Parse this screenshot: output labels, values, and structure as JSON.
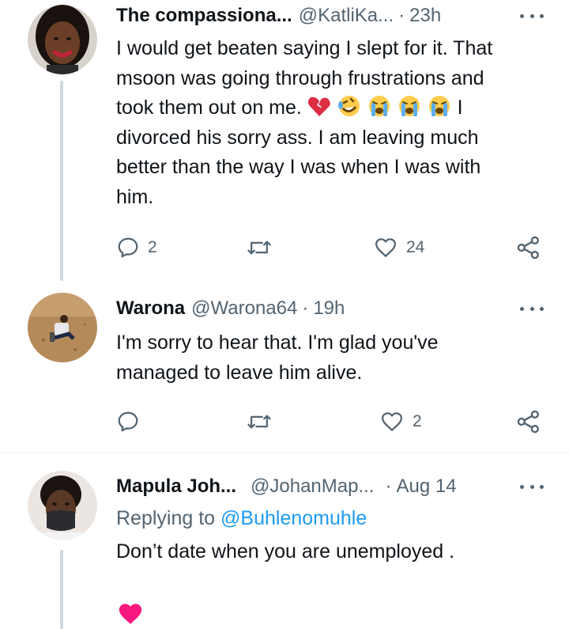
{
  "tweets": [
    {
      "name": "The compassiona...",
      "handle": "@KatliKa...",
      "separator": "·",
      "time": "23h",
      "lines": [
        "I would get beaten saying I slept for it. That",
        "msoon was going through frustrations and",
        "took them out on me.",
        "divorced his sorry ass. I am leaving much",
        "better than the way I was when I was with",
        "him."
      ],
      "line3_suffix": "I",
      "emojis": [
        "broken-heart-emoji",
        "rofl-emoji",
        "crying-face-emoji",
        "crying-face-emoji",
        "crying-face-emoji"
      ],
      "reply_count": "2",
      "retweet_count": "",
      "like_count": "24"
    },
    {
      "name": "Warona",
      "handle": "@Warona64",
      "separator": "·",
      "time": "19h",
      "lines": [
        "I'm sorry to hear that. I'm glad you've",
        "managed to leave him alive."
      ],
      "reply_count": "",
      "retweet_count": "",
      "like_count": "2"
    },
    {
      "name": "Mapula Joh...",
      "handle": "@JohanMap...",
      "separator": "·",
      "time": "Aug 14",
      "replying_label": "Replying to",
      "replying_handle": "@Buhlenomuhle",
      "lines": [
        "Don’t date when you are unemployed ."
      ],
      "liked": true
    }
  ],
  "colors": {
    "text": "#0f1419",
    "secondary": "#536471",
    "link": "#1d9bf0",
    "like_red": "#f91880",
    "thread_line": "#cfd9de"
  }
}
